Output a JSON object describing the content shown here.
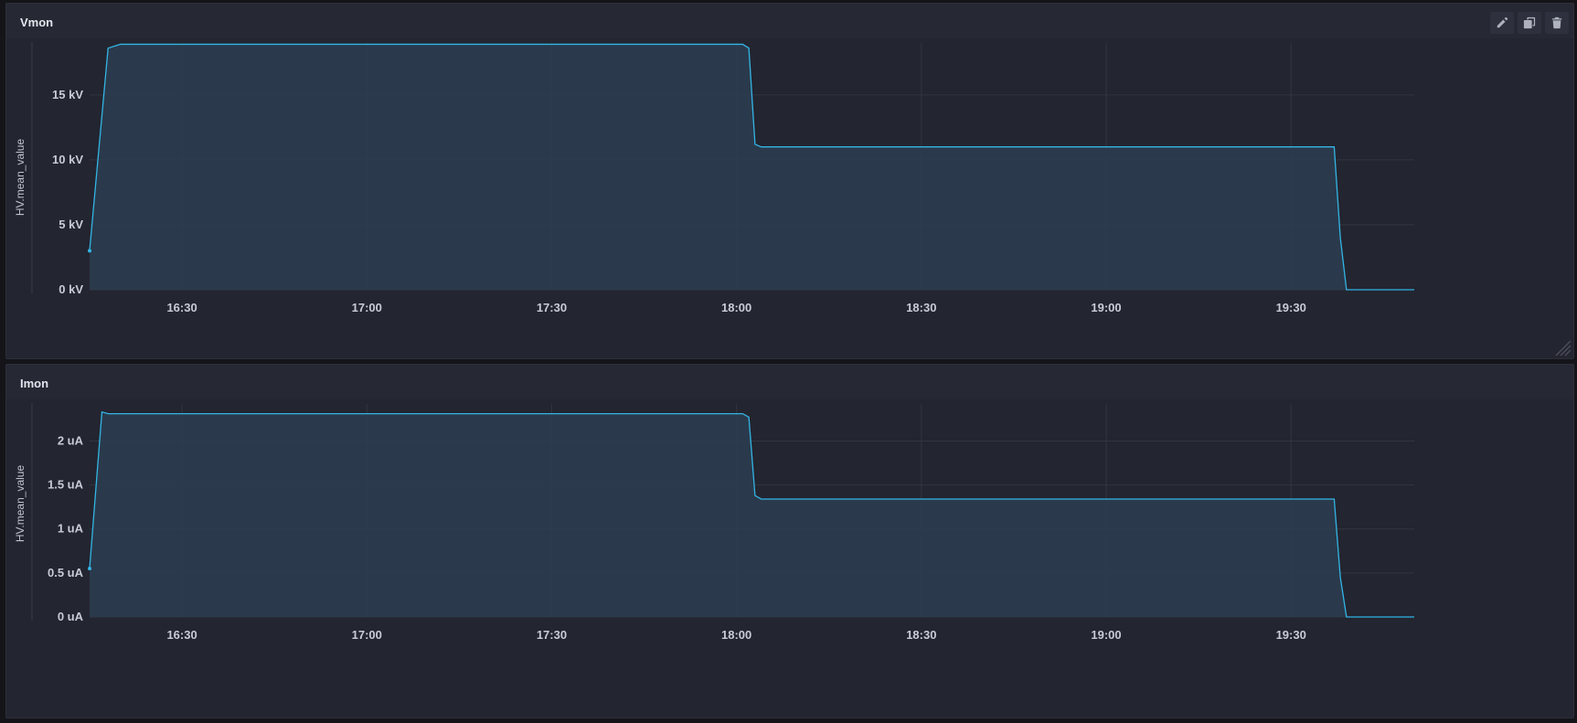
{
  "colors": {
    "series": "#33b5e5",
    "fill": "#2b3d50",
    "grid": "#33363f",
    "text": "#c8ccd6"
  },
  "panels": [
    {
      "title": "Vmon",
      "actions": [
        "pencil-icon",
        "duplicate-icon",
        "trash-icon"
      ]
    },
    {
      "title": "Imon"
    }
  ],
  "chart_data": [
    {
      "type": "area",
      "title": "Vmon",
      "xlabel": "",
      "ylabel": "HV.mean_value",
      "x_ticks": [
        "16:30",
        "17:00",
        "17:30",
        "18:00",
        "18:30",
        "19:00",
        "19:30"
      ],
      "y_ticks": [
        "0 kV",
        "5 kV",
        "10 kV",
        "15 kV"
      ],
      "ylim": [
        0,
        19
      ],
      "unit": "kV",
      "grid": true,
      "series": [
        {
          "values": [
            [
              "16:15",
              3.0
            ],
            [
              "16:18",
              18.6
            ],
            [
              "16:20",
              18.9
            ],
            [
              "17:00",
              18.9
            ],
            [
              "17:30",
              18.9
            ],
            [
              "18:01",
              18.9
            ],
            [
              "18:02",
              18.6
            ],
            [
              "18:03",
              11.2
            ],
            [
              "18:04",
              11.0
            ],
            [
              "18:30",
              11.0
            ],
            [
              "19:00",
              11.0
            ],
            [
              "19:37",
              11.0
            ],
            [
              "19:38",
              4.0
            ],
            [
              "19:39",
              0.0
            ],
            [
              "19:50",
              0.0
            ]
          ]
        }
      ]
    },
    {
      "type": "area",
      "title": "Imon",
      "xlabel": "",
      "ylabel": "HV.mean_value",
      "x_ticks": [
        "16:30",
        "17:00",
        "17:30",
        "18:00",
        "18:30",
        "19:00",
        "19:30"
      ],
      "y_ticks": [
        "0 uA",
        "0.5 uA",
        "1 uA",
        "1.5 uA",
        "2 uA"
      ],
      "ylim": [
        0,
        2.42
      ],
      "unit": "uA",
      "grid": true,
      "series": [
        {
          "values": [
            [
              "16:15",
              0.55
            ],
            [
              "16:17",
              2.33
            ],
            [
              "16:18",
              2.31
            ],
            [
              "17:00",
              2.31
            ],
            [
              "17:30",
              2.31
            ],
            [
              "18:01",
              2.31
            ],
            [
              "18:02",
              2.27
            ],
            [
              "18:03",
              1.38
            ],
            [
              "18:04",
              1.34
            ],
            [
              "18:30",
              1.34
            ],
            [
              "19:00",
              1.34
            ],
            [
              "19:37",
              1.34
            ],
            [
              "19:38",
              0.45
            ],
            [
              "19:39",
              0.0
            ],
            [
              "19:50",
              0.0
            ]
          ]
        }
      ]
    }
  ]
}
